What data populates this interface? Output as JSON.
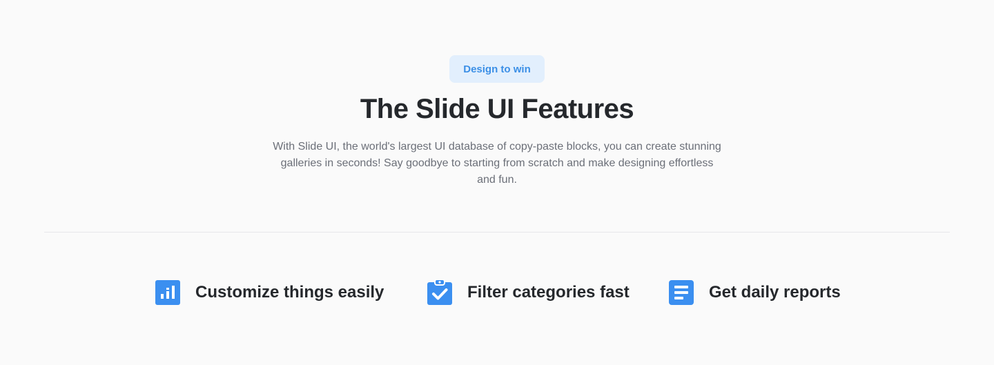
{
  "badge": {
    "label": "Design to win"
  },
  "heading": {
    "title": "The Slide UI Features"
  },
  "description": {
    "text": "With Slide UI, the world's largest UI database of copy-paste blocks, you can create stunning galleries in seconds! Say goodbye to starting from scratch and make designing effortless and fun."
  },
  "features": [
    {
      "icon": "bar-chart-icon",
      "label": "Customize things easily"
    },
    {
      "icon": "clipboard-check-icon",
      "label": "Filter categories fast"
    },
    {
      "icon": "document-lines-icon",
      "label": "Get daily reports"
    }
  ],
  "colors": {
    "accent": "#3b8fe6",
    "icon_blue": "#3b8ff0",
    "badge_bg": "#e2effd",
    "heading": "#25282c",
    "body_text": "#6b6f78",
    "background": "#fafafa"
  }
}
